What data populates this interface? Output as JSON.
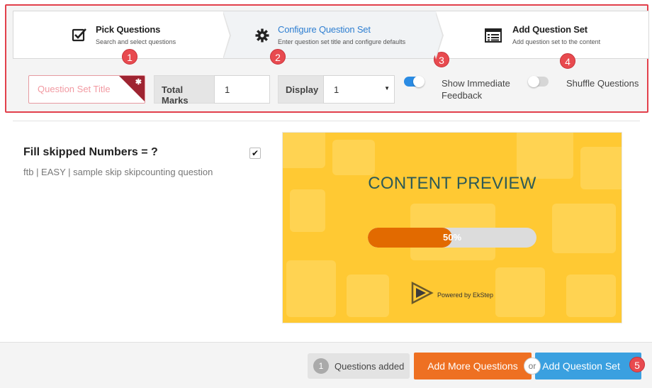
{
  "steps": [
    {
      "title": "Pick Questions",
      "subtitle": "Search and select questions",
      "icon": "checkbox-icon"
    },
    {
      "title": "Configure Question Set",
      "subtitle": "Enter question set title and configure defaults",
      "icon": "gear-icon"
    },
    {
      "title": "Add Question Set",
      "subtitle": "Add question set to the content",
      "icon": "list-icon"
    }
  ],
  "config": {
    "title_placeholder": "Question Set Title",
    "required_mark": "✱",
    "total_marks_label": "Total Marks",
    "total_marks_value": "1",
    "display_label": "Display",
    "display_value": "1",
    "immediate_feedback_label": "Show Immediate Feedback",
    "immediate_feedback_on": true,
    "shuffle_label": "Shuffle Questions",
    "shuffle_on": false
  },
  "badges": [
    "1",
    "2",
    "3",
    "4",
    "5"
  ],
  "question": {
    "title": "Fill skipped Numbers = ?",
    "meta": "ftb | EASY | sample skip skipcounting question",
    "checked": true
  },
  "preview": {
    "title": "CONTENT PREVIEW",
    "progress_label": "50%",
    "progress": 0.5,
    "powered_by": "Powered by EkStep"
  },
  "footer": {
    "count": "1",
    "added_label": "Questions added",
    "add_more_label": "Add More Questions",
    "or_label": "or",
    "add_set_label": "Add Question Set"
  },
  "colors": {
    "accent_blue": "#2a8be3",
    "badge_red": "#e84a4f",
    "orange": "#ee7022",
    "preview_yellow": "#ffc933"
  }
}
